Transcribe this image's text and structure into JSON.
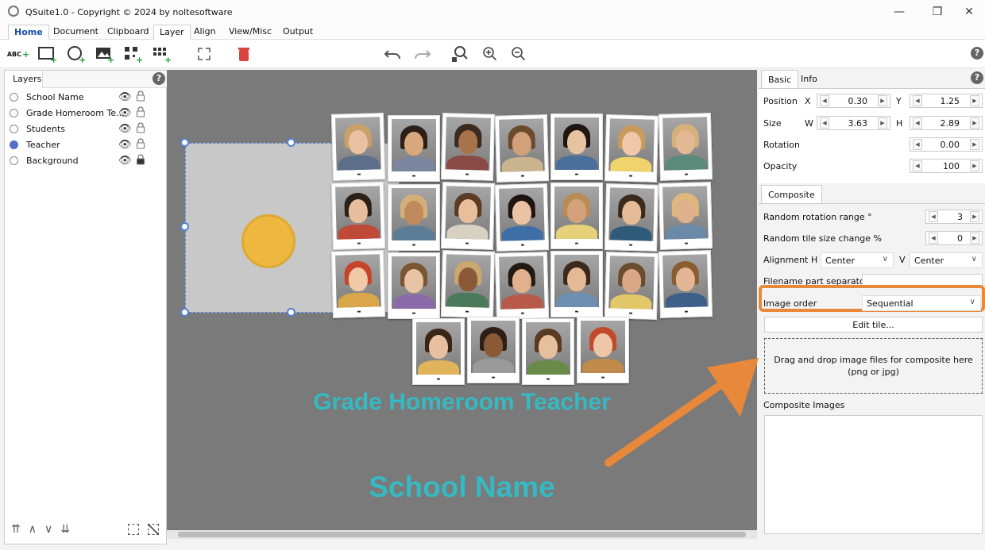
{
  "app": {
    "title": "QSuite1.0 - Copyright © 2024 by noltesoftware"
  },
  "menu": [
    {
      "label": "Home"
    },
    {
      "label": "Document"
    },
    {
      "label": "Clipboard"
    },
    {
      "label": "Layer"
    },
    {
      "label": "Align"
    },
    {
      "label": "View/Misc"
    },
    {
      "label": "Output"
    }
  ],
  "toolbar": {
    "abc_label": "ABC"
  },
  "layers": {
    "tab": "Layers",
    "items": [
      {
        "label": "School Name",
        "selected": false,
        "locked": false
      },
      {
        "label": "Grade Homeroom Te...",
        "selected": false,
        "locked": false
      },
      {
        "label": "Students",
        "selected": false,
        "locked": false
      },
      {
        "label": "Teacher",
        "selected": true,
        "locked": false
      },
      {
        "label": "Background",
        "selected": false,
        "locked": true
      }
    ]
  },
  "canvas": {
    "grade_text": "Grade Homeroom Teacher",
    "school_text": "School Name",
    "accent_text_color": "#35b9c2",
    "teacher_circle_color": "#f2b632"
  },
  "right": {
    "tabs": [
      {
        "label": "Basic"
      },
      {
        "label": "Info"
      }
    ],
    "position": {
      "label": "Position",
      "x_label": "X",
      "x": "0.30",
      "y_label": "Y",
      "y": "1.25"
    },
    "size": {
      "label": "Size",
      "w_label": "W",
      "w": "3.63",
      "h_label": "H",
      "h": "2.89"
    },
    "rotation": {
      "label": "Rotation",
      "value": "0.00"
    },
    "opacity": {
      "label": "Opacity",
      "value": "100"
    },
    "composite_tab": "Composite",
    "random_rotation": {
      "label": "Random rotation range °",
      "value": "3"
    },
    "random_size": {
      "label": "Random tile size change %",
      "value": "0"
    },
    "alignment": {
      "label": "Alignment",
      "h_label": "H",
      "h": "Center",
      "v_label": "V",
      "v": "Center"
    },
    "filename_sep": {
      "label": "Filename part separator"
    },
    "image_order": {
      "label": "Image order",
      "value": "Sequential"
    },
    "edit_tile": "Edit tile...",
    "dropzone": "Drag and drop image files for composite here (png or jpg)",
    "composite_images_label": "Composite Images",
    "highlight_color": "#e8883a"
  }
}
